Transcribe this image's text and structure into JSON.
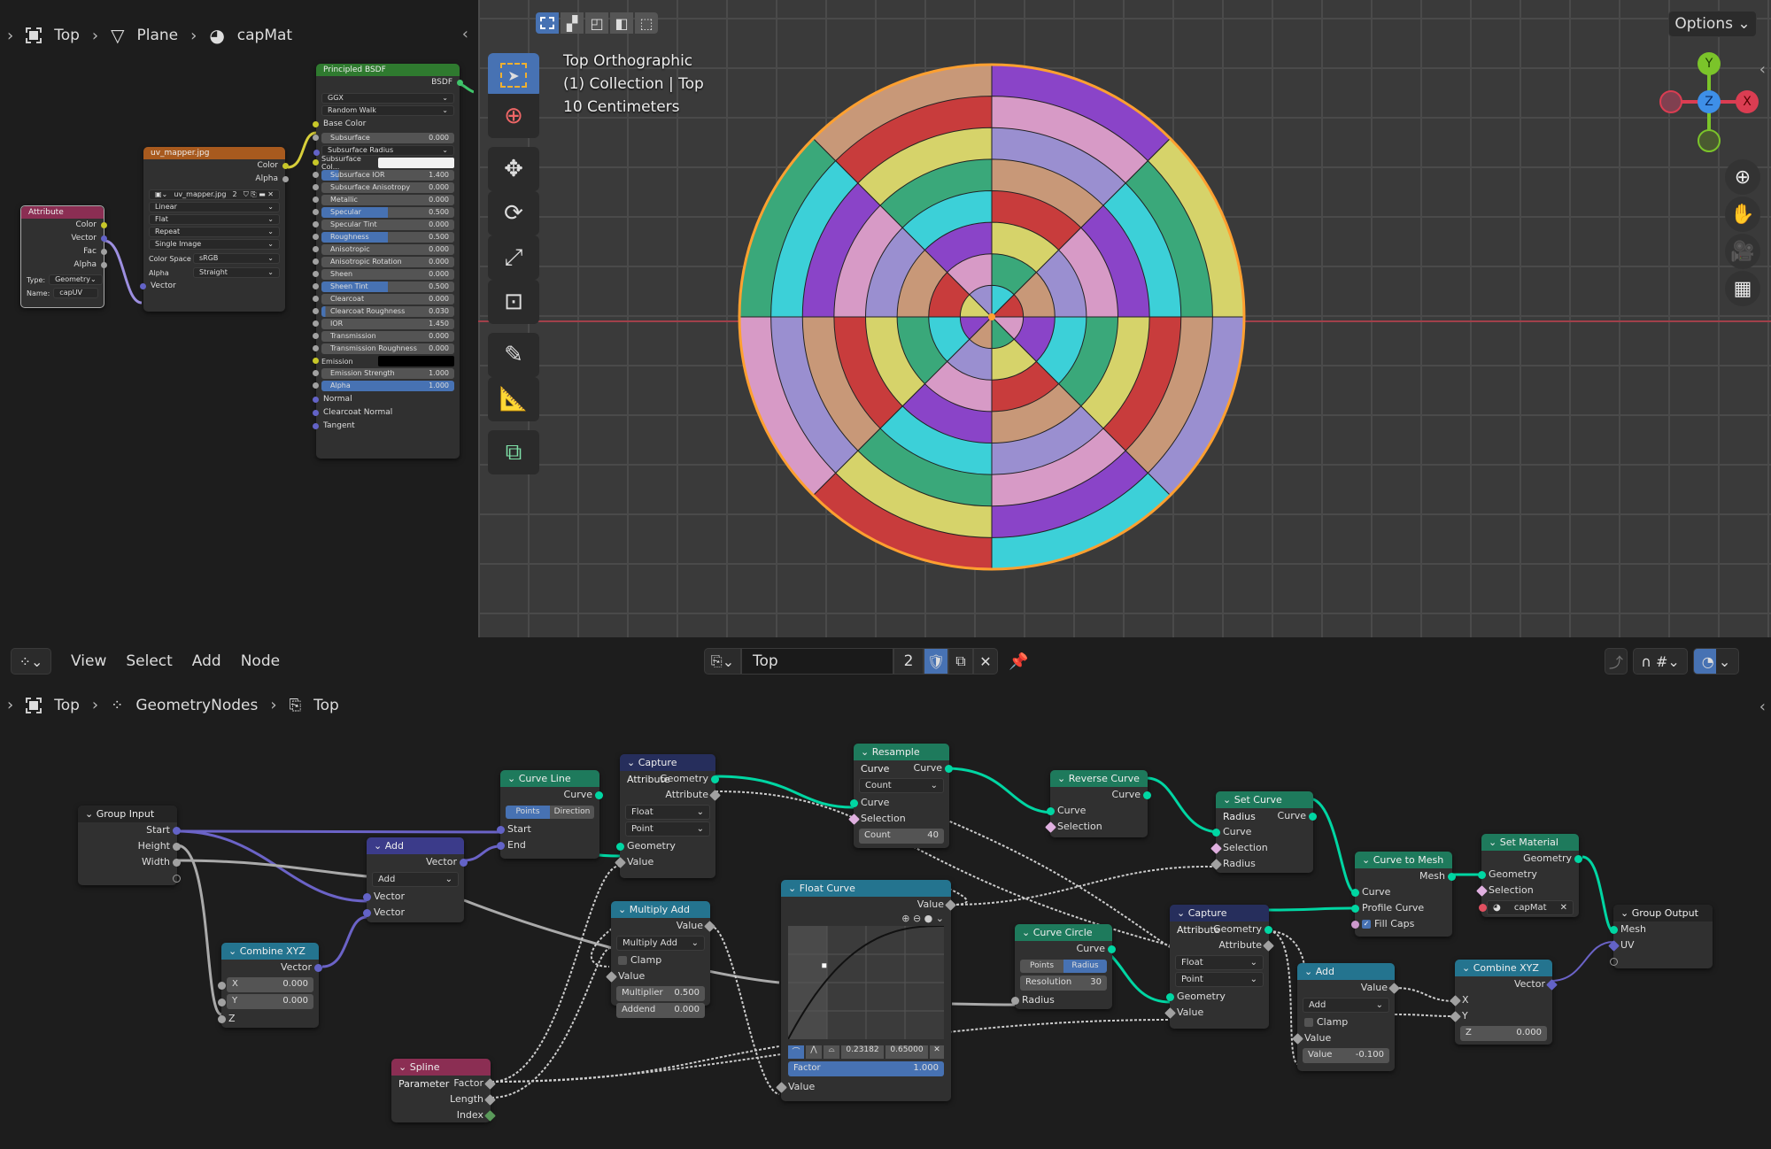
{
  "shader_editor": {
    "breadcrumb": [
      {
        "icon": "object-icon",
        "label": "Top"
      },
      {
        "icon": "mesh-icon",
        "label": "Plane"
      },
      {
        "icon": "material-icon",
        "label": "capMat"
      }
    ],
    "nodes": {
      "attribute": {
        "title": "Attribute",
        "outputs": [
          "Color",
          "Vector",
          "Fac",
          "Alpha"
        ],
        "type_label": "Type:",
        "type_value": "Geometry",
        "name_label": "Name:",
        "name_value": "capUV"
      },
      "image": {
        "title": "uv_mapper.jpg",
        "outputs": [
          "Color",
          "Alpha"
        ],
        "image_name": "uv_mapper.jpg",
        "users": "2",
        "interpolation": "Linear",
        "projection": "Flat",
        "extension": "Repeat",
        "source": "Single Image",
        "color_space_label": "Color Space",
        "color_space": "sRGB",
        "alpha_label": "Alpha",
        "alpha_mode": "Straight",
        "input": "Vector"
      },
      "bsdf": {
        "title": "Principled BSDF",
        "output": "BSDF",
        "distribution": "GGX",
        "subsurface_method": "Random Walk",
        "fields": [
          {
            "label": "Base Color",
            "kind": "socket"
          },
          {
            "label": "Subsurface",
            "value": "0.000",
            "fill": 0
          },
          {
            "label": "Subsurface Radius",
            "kind": "select"
          },
          {
            "label": "Subsurface Col...",
            "kind": "color",
            "color": "#f0f0f0"
          },
          {
            "label": "Subsurface IOR",
            "value": "1.400",
            "fill": 0.13
          },
          {
            "label": "Subsurface Anisotropy",
            "value": "0.000",
            "fill": 0
          },
          {
            "label": "Metallic",
            "value": "0.000",
            "fill": 0
          },
          {
            "label": "Specular",
            "value": "0.500",
            "fill": 0.5
          },
          {
            "label": "Specular Tint",
            "value": "0.000",
            "fill": 0
          },
          {
            "label": "Roughness",
            "value": "0.500",
            "fill": 0.5
          },
          {
            "label": "Anisotropic",
            "value": "0.000",
            "fill": 0
          },
          {
            "label": "Anisotropic Rotation",
            "value": "0.000",
            "fill": 0
          },
          {
            "label": "Sheen",
            "value": "0.000",
            "fill": 0
          },
          {
            "label": "Sheen Tint",
            "value": "0.500",
            "fill": 0.5
          },
          {
            "label": "Clearcoat",
            "value": "0.000",
            "fill": 0
          },
          {
            "label": "Clearcoat Roughness",
            "value": "0.030",
            "fill": 0.03
          },
          {
            "label": "IOR",
            "value": "1.450",
            "fill": 0
          },
          {
            "label": "Transmission",
            "value": "0.000",
            "fill": 0
          },
          {
            "label": "Transmission Roughness",
            "value": "0.000",
            "fill": 0
          },
          {
            "label": "Emission",
            "kind": "color",
            "color": "#000000"
          },
          {
            "label": "Emission Strength",
            "value": "1.000",
            "fill": 0
          },
          {
            "label": "Alpha",
            "value": "1.000",
            "fill": 1
          },
          {
            "label": "Normal",
            "kind": "socket"
          },
          {
            "label": "Clearcoat Normal",
            "kind": "socket"
          },
          {
            "label": "Tangent",
            "kind": "socket"
          }
        ]
      }
    }
  },
  "viewport": {
    "overlay_lines": [
      "Top Orthographic",
      "(1) Collection | Top",
      "10 Centimeters"
    ],
    "options_label": "Options",
    "gizmo": {
      "y": "Y",
      "z": "Z",
      "x": "X"
    },
    "tools": [
      "select-box-icon",
      "cursor-icon",
      "move-icon",
      "rotate-icon",
      "scale-icon",
      "transform-icon",
      "annotate-icon",
      "measure-icon",
      "add-cube-icon"
    ],
    "colors": {
      "axis_x": "#db3d52",
      "axis_y": "#7bc42a",
      "axis_z": "#3e8fe8",
      "selection": "#ffa030"
    }
  },
  "geometry_editor": {
    "menu": [
      "View",
      "Select",
      "Add",
      "Node"
    ],
    "node_tree": {
      "name": "Top",
      "users": "2"
    },
    "breadcrumb": [
      {
        "icon": "object-icon",
        "label": "Top"
      },
      {
        "icon": "geometry-nodes-icon",
        "label": "GeometryNodes"
      },
      {
        "icon": "node-tree-icon",
        "label": "Top"
      }
    ],
    "nodes": {
      "group_input": {
        "title": "Group Input",
        "outputs": [
          "Start",
          "Height",
          "Width"
        ]
      },
      "add_vec": {
        "title": "Add",
        "output": "Vector",
        "operation": "Add",
        "inputs": [
          "Vector",
          "Vector"
        ]
      },
      "combine1": {
        "title": "Combine XYZ",
        "output": "Vector",
        "x_label": "X",
        "x": "0.000",
        "y_label": "Y",
        "y": "0.000",
        "z_label": "Z"
      },
      "curve_line": {
        "title": "Curve Line",
        "output": "Curve",
        "mode_a": "Points",
        "mode_b": "Direction",
        "inputs": [
          "Start",
          "End"
        ]
      },
      "capture1": {
        "title": "Capture Attribute",
        "outputs": [
          "Geometry",
          "Attribute"
        ],
        "data_type": "Float",
        "domain": "Point",
        "inputs": [
          "Geometry",
          "Value"
        ]
      },
      "resample": {
        "title": "Resample Curve",
        "output": "Curve",
        "mode": "Count",
        "inputs": [
          "Curve",
          "Selection"
        ],
        "count_label": "Count",
        "count": "40"
      },
      "multiply_add": {
        "title": "Multiply Add",
        "output": "Value",
        "operation": "Multiply Add",
        "clamp": "Clamp",
        "input": "Value",
        "mult_label": "Multiplier",
        "mult": "0.500",
        "add_label": "Addend",
        "add": "0.000"
      },
      "float_curve": {
        "title": "Float Curve",
        "output": "Value",
        "point_x": "0.23182",
        "point_y": "0.65000",
        "factor_label": "Factor",
        "factor": "1.000",
        "input": "Value"
      },
      "spline_param": {
        "title": "Spline Parameter",
        "outputs": [
          "Factor",
          "Length",
          "Index"
        ]
      },
      "reverse": {
        "title": "Reverse Curve",
        "output": "Curve",
        "inputs": [
          "Curve",
          "Selection"
        ]
      },
      "set_radius": {
        "title": "Set Curve Radius",
        "output": "Curve",
        "inputs": [
          "Curve",
          "Selection",
          "Radius"
        ]
      },
      "curve_circle": {
        "title": "Curve Circle",
        "output": "Curve",
        "mode_a": "Points",
        "mode_b": "Radius",
        "res_label": "Resolution",
        "res": "30",
        "input": "Radius"
      },
      "capture2": {
        "title": "Capture Attribute",
        "outputs": [
          "Geometry",
          "Attribute"
        ],
        "data_type": "Float",
        "domain": "Point",
        "inputs": [
          "Geometry",
          "Value"
        ]
      },
      "curve_to_mesh": {
        "title": "Curve to Mesh",
        "output": "Mesh",
        "inputs": [
          "Curve",
          "Profile Curve"
        ],
        "fill_caps": "Fill Caps"
      },
      "set_material": {
        "title": "Set Material",
        "output": "Geometry",
        "inputs": [
          "Geometry",
          "Selection"
        ],
        "material": "capMat"
      },
      "add_float": {
        "title": "Add",
        "output": "Value",
        "operation": "Add",
        "clamp": "Clamp",
        "input": "Value",
        "value_label": "Value",
        "value": "-0.100"
      },
      "combine2": {
        "title": "Combine XYZ",
        "output": "Vector",
        "inputs": [
          "X",
          "Y"
        ],
        "z_label": "Z",
        "z": "0.000"
      },
      "group_output": {
        "title": "Group Output",
        "inputs": [
          "Mesh",
          "UV"
        ]
      }
    }
  }
}
